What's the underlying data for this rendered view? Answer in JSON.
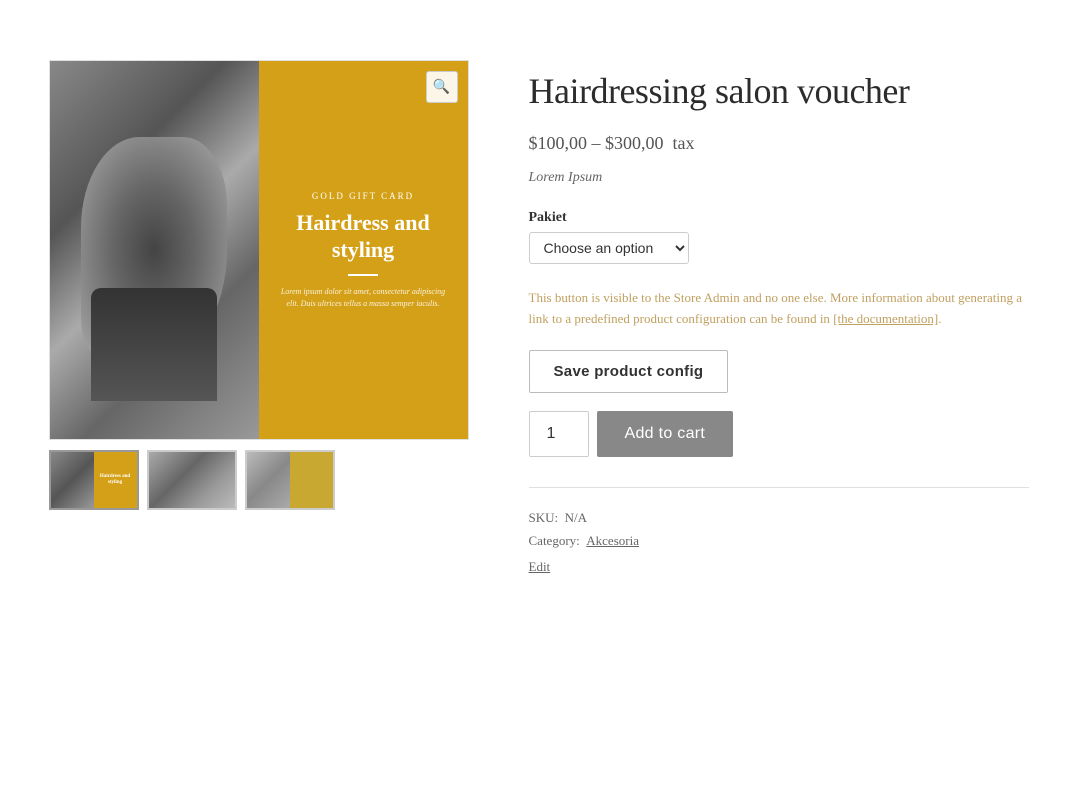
{
  "product": {
    "title": "Hairdressing salon voucher",
    "price_range": "$100,00 – $300,00",
    "price_suffix": "tax",
    "description": "Lorem Ipsum",
    "sku_label": "SKU:",
    "sku_value": "N/A",
    "category_label": "Category:",
    "category_value": "Akcesoria",
    "edit_link": "Edit"
  },
  "gift_card": {
    "label": "GOLD GIFT CARD",
    "title": "Hairdress and styling",
    "body": "Lorem ipsum dolor sit amet, consectetur adipiscing elit. Duis ultrices tellus a massa semper iaculis."
  },
  "option": {
    "label": "Pakiet",
    "placeholder": "Choose an option",
    "options": [
      "Choose an option"
    ]
  },
  "admin_notice": {
    "text1": "This button is visible to the Store Admin and no one else. More information about generating a link to a predefined product configuration can be found in ",
    "link_text": "[the documentation]",
    "text2": "."
  },
  "buttons": {
    "save_config": "Save product config",
    "add_to_cart": "Add to cart"
  },
  "quantity": {
    "value": 1
  },
  "zoom_icon": "🔍"
}
